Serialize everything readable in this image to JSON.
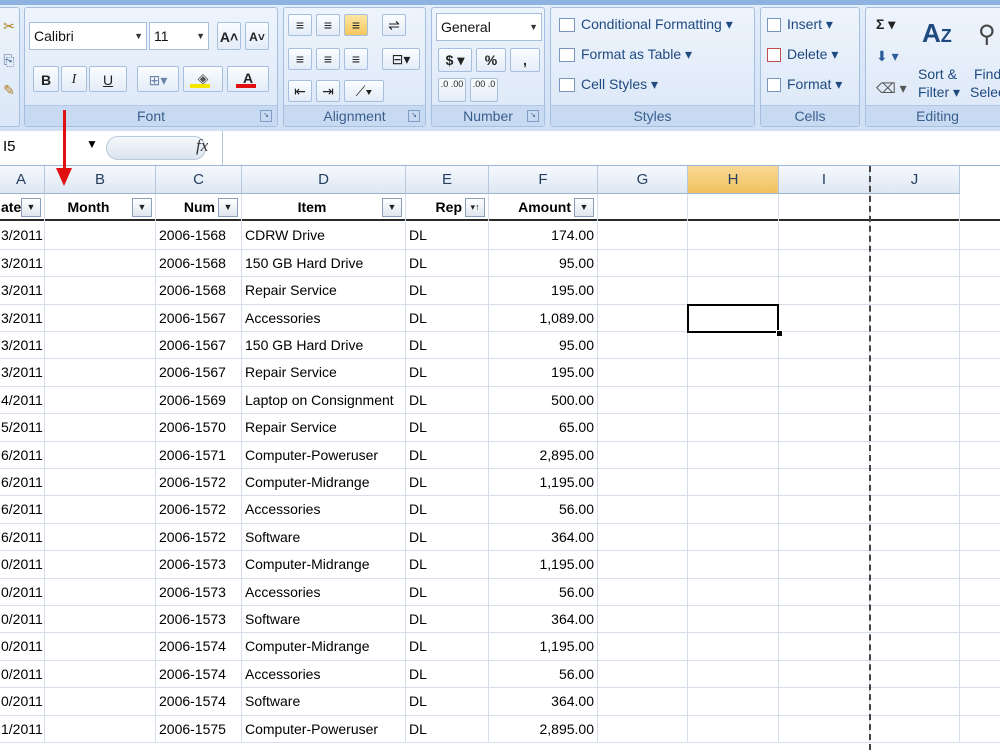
{
  "ribbon": {
    "font": {
      "label": "Font",
      "font_name": "Calibri",
      "font_size": "11",
      "grow": "A",
      "shrink": "A",
      "bold": "B",
      "italic": "I",
      "underline": "U",
      "font_color_letter": "A"
    },
    "alignment": {
      "label": "Alignment"
    },
    "number": {
      "label": "Number",
      "format": "General",
      "currency": "$",
      "percent": "%",
      "comma": ",",
      "inc_decimal": ".0 .00",
      "dec_decimal": ".00 .0"
    },
    "styles": {
      "label": "Styles",
      "conditional": "Conditional Formatting",
      "table": "Format as Table",
      "cell": "Cell Styles"
    },
    "cells": {
      "label": "Cells",
      "insert": "Insert",
      "delete": "Delete",
      "format": "Format"
    },
    "editing": {
      "label": "Editing",
      "sigma": "Σ",
      "sort": "Sort &",
      "filter": "Filter",
      "find": "Find",
      "select": "Selec"
    }
  },
  "formula_bar": {
    "name_box": "I5",
    "fx": "fx"
  },
  "columns": [
    "A",
    "B",
    "C",
    "D",
    "E",
    "F",
    "G",
    "H",
    "I",
    "J"
  ],
  "selected_column": "H",
  "table": {
    "headers": [
      "ate",
      "Month",
      "Num",
      "Item",
      "Rep",
      "Amount"
    ],
    "rows": [
      [
        "3/2011",
        "",
        "2006-1568",
        "CDRW Drive",
        "DL",
        "174.00"
      ],
      [
        "3/2011",
        "",
        "2006-1568",
        "150 GB Hard Drive",
        "DL",
        "95.00"
      ],
      [
        "3/2011",
        "",
        "2006-1568",
        "Repair Service",
        "DL",
        "195.00"
      ],
      [
        "3/2011",
        "",
        "2006-1567",
        "Accessories",
        "DL",
        "1,089.00"
      ],
      [
        "3/2011",
        "",
        "2006-1567",
        "150 GB Hard Drive",
        "DL",
        "95.00"
      ],
      [
        "3/2011",
        "",
        "2006-1567",
        "Repair Service",
        "DL",
        "195.00"
      ],
      [
        "4/2011",
        "",
        "2006-1569",
        "Laptop on Consignment",
        "DL",
        "500.00"
      ],
      [
        "5/2011",
        "",
        "2006-1570",
        "Repair Service",
        "DL",
        "65.00"
      ],
      [
        "6/2011",
        "",
        "2006-1571",
        "Computer-Poweruser",
        "DL",
        "2,895.00"
      ],
      [
        "6/2011",
        "",
        "2006-1572",
        "Computer-Midrange",
        "DL",
        "1,195.00"
      ],
      [
        "6/2011",
        "",
        "2006-1572",
        "Accessories",
        "DL",
        "56.00"
      ],
      [
        "6/2011",
        "",
        "2006-1572",
        "Software",
        "DL",
        "364.00"
      ],
      [
        "0/2011",
        "",
        "2006-1573",
        "Computer-Midrange",
        "DL",
        "1,195.00"
      ],
      [
        "0/2011",
        "",
        "2006-1573",
        "Accessories",
        "DL",
        "56.00"
      ],
      [
        "0/2011",
        "",
        "2006-1573",
        "Software",
        "DL",
        "364.00"
      ],
      [
        "0/2011",
        "",
        "2006-1574",
        "Computer-Midrange",
        "DL",
        "1,195.00"
      ],
      [
        "0/2011",
        "",
        "2006-1574",
        "Accessories",
        "DL",
        "56.00"
      ],
      [
        "0/2011",
        "",
        "2006-1574",
        "Software",
        "DL",
        "364.00"
      ],
      [
        "1/2011",
        "",
        "2006-1575",
        "Computer-Poweruser",
        "DL",
        "2,895.00"
      ]
    ]
  },
  "colors": {
    "ribbon_bg": "#dbe7f7",
    "selected_header": "#f1c15f",
    "arrow": "#e01010"
  }
}
